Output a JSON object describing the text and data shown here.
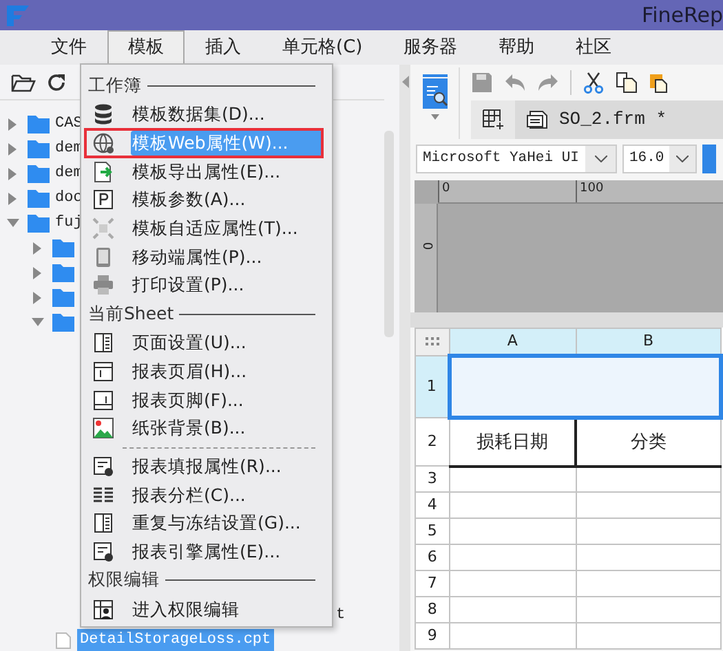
{
  "title_bar": {
    "title": "FineRep"
  },
  "menu_bar": [
    {
      "label": "文件",
      "selected": false
    },
    {
      "label": "模板",
      "selected": true
    },
    {
      "label": "插入",
      "selected": false
    },
    {
      "label": "单元格(C)",
      "selected": false
    },
    {
      "label": "服务器",
      "selected": false
    },
    {
      "label": "帮助",
      "selected": false
    },
    {
      "label": "社区",
      "selected": false
    }
  ],
  "file_tree": [
    {
      "label": "CAS",
      "expanded": false
    },
    {
      "label": "dem",
      "expanded": false
    },
    {
      "label": "dem",
      "expanded": false
    },
    {
      "label": "doc",
      "expanded": false
    },
    {
      "label": "fuj",
      "expanded": true,
      "children": [
        {
          "expanded": false
        },
        {
          "expanded": false
        },
        {
          "expanded": false
        },
        {
          "expanded": true,
          "children": [
            {
              "kind": "clipped",
              "label": "t",
              "selected": false
            },
            {
              "kind": "file",
              "label": "DetailStorageLoss.cpt",
              "selected": true
            }
          ]
        }
      ]
    }
  ],
  "template_menu": [
    {
      "header": "工作簿",
      "items": [
        {
          "kind": "database",
          "label": "模板数据集(D)...",
          "selected": false
        },
        {
          "kind": "globe",
          "label": "模板Web属性(W)...",
          "selected": true,
          "outlined": true
        },
        {
          "kind": "export",
          "label": "模板导出属性(E)...",
          "selected": false
        },
        {
          "kind": "param",
          "label": "模板参数(A)...",
          "selected": false
        },
        {
          "kind": "fit",
          "label": "模板自适应属性(T)...",
          "selected": false
        },
        {
          "kind": "tablet",
          "label": "移动端属性(P)...",
          "selected": false
        },
        {
          "kind": "printer",
          "label": "打印设置(P)...",
          "selected": false
        }
      ]
    },
    {
      "header": "当前Sheet",
      "items": [
        {
          "kind": "page",
          "label": "页面设置(U)...",
          "selected": false
        },
        {
          "kind": "header",
          "label": "报表页眉(H)...",
          "selected": false
        },
        {
          "kind": "footer",
          "label": "报表页脚(F)...",
          "selected": false
        },
        {
          "kind": "image",
          "label": "纸张背景(B)...",
          "selected": false
        },
        {
          "kind": "formgear",
          "label": "报表填报属性(R)...",
          "selected": false,
          "separator_before": true
        },
        {
          "kind": "columns",
          "label": "报表分栏(C)...",
          "selected": false
        },
        {
          "kind": "page",
          "label": "重复与冻结设置(G)...",
          "selected": false
        },
        {
          "kind": "formgear",
          "label": "报表引擎属性(E)...",
          "selected": false
        }
      ]
    },
    {
      "header": "权限编辑",
      "items": [
        {
          "kind": "permission",
          "label": "进入权限编辑",
          "selected": false
        }
      ]
    }
  ],
  "document_tab": {
    "label": "SO_2.frm *"
  },
  "font_family": {
    "value": "Microsoft YaHei UI"
  },
  "font_size": {
    "value": "16.0"
  },
  "ruler": {
    "top_labels": [
      "0",
      "100"
    ],
    "left_labels": [
      "0"
    ]
  },
  "sheet": {
    "columns": [
      "A",
      "B"
    ],
    "rows": [
      {
        "number": "1",
        "selected": true
      },
      {
        "number": "2",
        "selected": false,
        "cells": [
          "损耗日期",
          "分类"
        ]
      },
      {
        "number": "3",
        "selected": false
      },
      {
        "number": "4",
        "selected": false
      },
      {
        "number": "5",
        "selected": false
      },
      {
        "number": "6",
        "selected": false
      },
      {
        "number": "7",
        "selected": false
      },
      {
        "number": "8",
        "selected": false
      },
      {
        "number": "9",
        "selected": false
      }
    ]
  }
}
